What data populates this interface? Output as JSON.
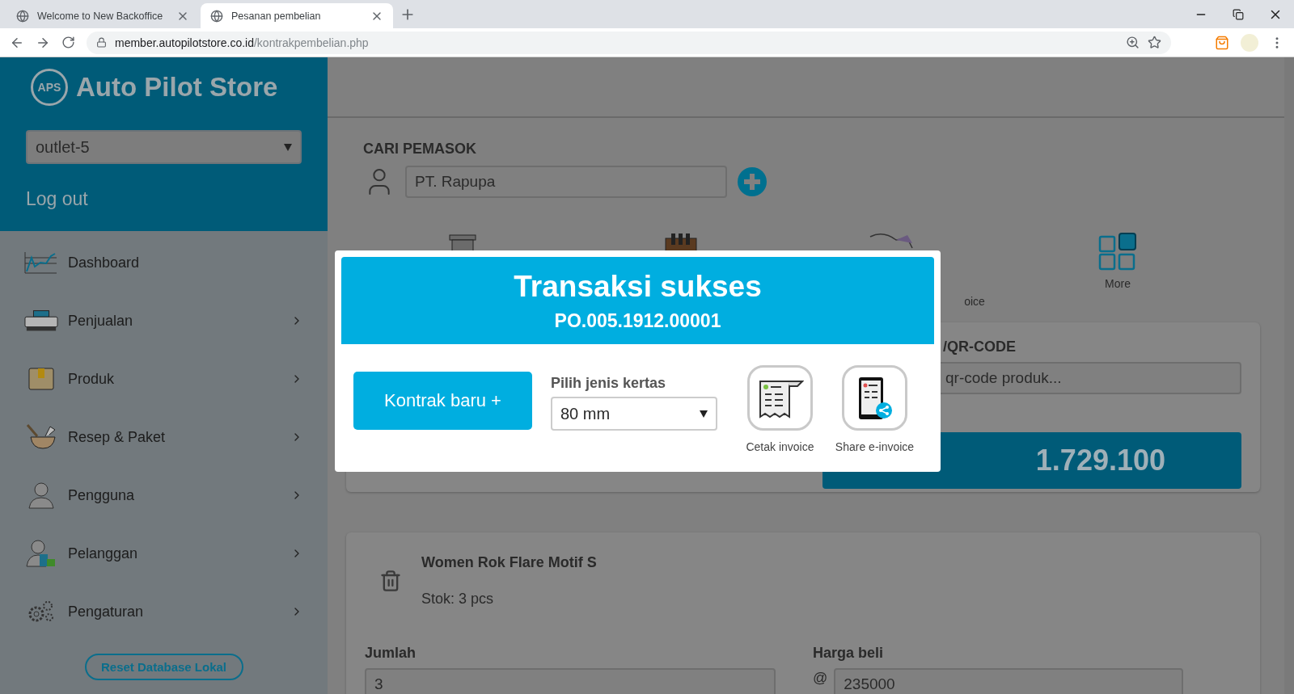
{
  "browser": {
    "tabs": [
      {
        "title": "Welcome to New Backoffice",
        "selected": false
      },
      {
        "title": "Pesanan pembelian",
        "selected": true
      }
    ],
    "url": {
      "host": "member.autopilotstore.co.id",
      "path": "/kontrakpembelian.php"
    }
  },
  "sidebar": {
    "logo_text": "APS",
    "brand": "Auto Pilot Store",
    "outlet": "outlet-5",
    "logout": "Log out",
    "items": [
      {
        "label": "Dashboard",
        "has_submenu": false
      },
      {
        "label": "Penjualan",
        "has_submenu": true
      },
      {
        "label": "Produk",
        "has_submenu": true
      },
      {
        "label": "Resep & Paket",
        "has_submenu": true
      },
      {
        "label": "Pengguna",
        "has_submenu": true
      },
      {
        "label": "Pelanggan",
        "has_submenu": true
      },
      {
        "label": "Pengaturan",
        "has_submenu": true
      }
    ],
    "reset_button": "Reset Database Lokal"
  },
  "supplier": {
    "heading": "CARI PEMASOK",
    "value": "PT. Rapupa"
  },
  "features": [
    {
      "label": "oice"
    },
    {
      "label": "More"
    }
  ],
  "scan": {
    "heading": "/QR-CODE",
    "placeholder": "qr-code produk...",
    "total": "1.729.100"
  },
  "item": {
    "name": "Women Rok Flare Motif S",
    "stock": "Stok: 3 pcs",
    "qty_label": "Jumlah",
    "qty": "3",
    "price_label": "Harga beli",
    "price_prefix": "@",
    "price": "235000"
  },
  "modal": {
    "title": "Transaksi sukses",
    "number": "PO.005.1912.00001",
    "new_button": "Kontrak baru +",
    "paper_label": "Pilih jenis kertas",
    "paper": "80 mm",
    "actions": [
      {
        "label": "Cetak invoice"
      },
      {
        "label": "Share e-invoice"
      }
    ]
  }
}
